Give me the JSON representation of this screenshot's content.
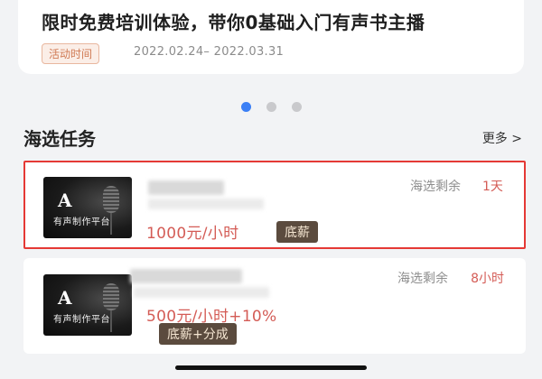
{
  "promo": {
    "title": "限时免费培训体验，带你0基础入门有声书主播",
    "tag": "活动时间",
    "date_range": "2022.02.24– 2022.03.31"
  },
  "carousel": {
    "total": 3,
    "active_index": 0
  },
  "section": {
    "title": "海选任务",
    "more_label": "更多 >"
  },
  "tasks": [
    {
      "thumb_text": "有声制作平台",
      "logo_letter": "A",
      "price": "1000元/小时",
      "badge": "底薪",
      "remain_label": "海选剩余",
      "remain_value": "1天",
      "highlighted": true
    },
    {
      "thumb_text": "有声制作平台",
      "logo_letter": "A",
      "price": "500元/小时+10%",
      "badge": "底薪+分成",
      "remain_label": "海选剩余",
      "remain_value": "8小时",
      "highlighted": false
    }
  ],
  "colors": {
    "accent_blue": "#3b7ff5",
    "price_red": "#d45c56",
    "highlight_border": "#e53935",
    "badge_bg": "#5b4b3e"
  }
}
